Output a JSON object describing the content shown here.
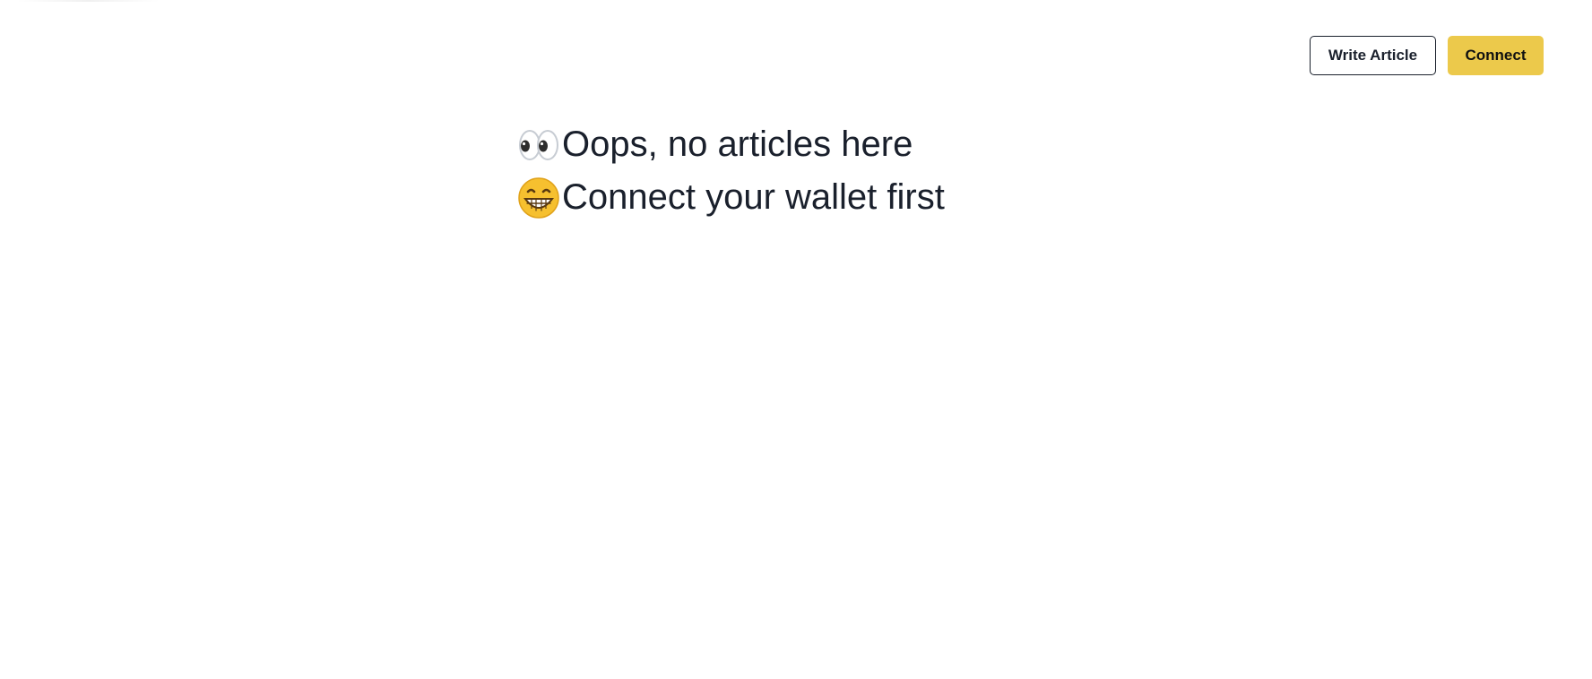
{
  "header": {
    "write_article_label": "Write Article",
    "connect_label": "Connect"
  },
  "main": {
    "lines": [
      {
        "icon": "eyes-icon",
        "text": "Oops, no articles here"
      },
      {
        "icon": "grinning-face-icon",
        "text": "Connect your wallet first"
      }
    ]
  },
  "colors": {
    "accent": "#ecc94b",
    "text": "#1a202c",
    "background": "#ffffff"
  }
}
